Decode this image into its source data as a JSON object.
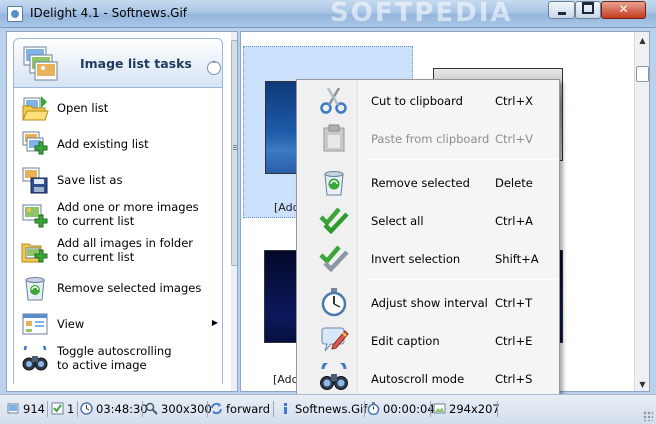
{
  "window": {
    "title": "IDelight 4.1 - Softnews.Gif",
    "watermark": "SOFTPEDIA",
    "minimize_label": "",
    "maximize_label": "",
    "close_label": "✕"
  },
  "task_panel": {
    "title": "Image list tasks",
    "collapse_glyph": "⌃",
    "items": [
      {
        "label": "Open list",
        "icon": "folder-open-icon"
      },
      {
        "label": "Add existing list",
        "icon": "add-list-icon"
      },
      {
        "label": "Save list as",
        "icon": "save-list-icon"
      },
      {
        "label_line1": "Add one or more images",
        "label_line2": "to current list",
        "icon": "add-images-icon"
      },
      {
        "label_line1": "Add all images in folder",
        "label_line2": "to current list",
        "icon": "add-folder-images-icon"
      },
      {
        "label": "Remove selected images",
        "icon": "recycle-bin-icon"
      },
      {
        "label": "View",
        "icon": "view-icon",
        "arrow": "▶"
      },
      {
        "label_line1": "Toggle autoscrolling",
        "label_line2": "to active image",
        "icon": "binoculars-icon"
      }
    ]
  },
  "thumbnails": [
    {
      "caption": "[Add"
    },
    {
      "caption": ""
    },
    {
      "caption": "[Add"
    },
    {
      "caption": ""
    }
  ],
  "context_menu": {
    "items": [
      {
        "label": "Cut to clipboard",
        "shortcut": "Ctrl+X",
        "icon": "scissors-icon",
        "enabled": true
      },
      {
        "label": "Paste from clipboard",
        "shortcut": "Ctrl+V",
        "icon": "clipboard-icon",
        "enabled": false
      },
      {
        "label": "Remove selected",
        "shortcut": "Delete",
        "icon": "recycle-bin-icon",
        "enabled": true
      },
      {
        "label": "Select all",
        "shortcut": "Ctrl+A",
        "icon": "double-check-icon",
        "enabled": true
      },
      {
        "label": "Invert selection",
        "shortcut": "Shift+A",
        "icon": "double-check-gray-icon",
        "enabled": true
      },
      {
        "label": "Adjust show interval",
        "shortcut": "Ctrl+T",
        "icon": "stopwatch-icon",
        "enabled": true
      },
      {
        "label": "Edit caption",
        "shortcut": "Ctrl+E",
        "icon": "speech-bubble-pencil-icon",
        "enabled": true
      },
      {
        "label": "Autoscroll mode",
        "shortcut": "Ctrl+S",
        "icon": "binoculars-icon",
        "enabled": true
      }
    ]
  },
  "statusbar": {
    "image_count": "914",
    "checked_count": "1",
    "duration": "03:48:30",
    "thumb_size": "300x300",
    "direction": "forward",
    "file_name": "Softnews.Gif",
    "interval": "00:00:04",
    "image_size": "294x207"
  },
  "colors": {
    "accent": "#3b7ac4",
    "selection": "#cbe1fc",
    "check_green": "#3aa63a",
    "close_red": "#c73a1f"
  }
}
